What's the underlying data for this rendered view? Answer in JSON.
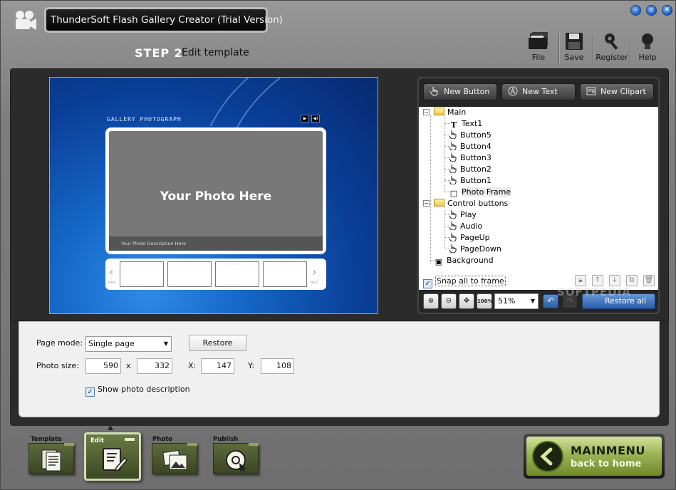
{
  "titlebar": {
    "title": "ThunderSoft Flash Gallery Creator (Trial Version)",
    "window_buttons": [
      "minimize-icon",
      "maximize-icon",
      "close-icon"
    ]
  },
  "header": {
    "step_label": "STEP 2",
    "step_title": "Edit template"
  },
  "toolbar": {
    "items": [
      {
        "label": "File",
        "icon": "folder-icon"
      },
      {
        "label": "Save",
        "icon": "floppy-disk-icon"
      },
      {
        "label": "Register",
        "icon": "key-icon"
      },
      {
        "label": "Help",
        "icon": "lightbulb-icon"
      }
    ]
  },
  "preview": {
    "gallery_title": "GALLERY PHOTOGRAPH",
    "photo_placeholder": "Your Photo Here",
    "photo_description": "Your Photo Description Here",
    "prev_label": "PREV",
    "next_label": "NEXT"
  },
  "editor_panel": {
    "buttons": {
      "new_button": "New Button",
      "new_text": "New Text",
      "new_clipart": "New Clipart"
    },
    "tree": {
      "main": "Main",
      "main_children": [
        "Text1",
        "Button5",
        "Button4",
        "Button3",
        "Button2",
        "Button1",
        "Photo Frame"
      ],
      "control_buttons": "Control buttons",
      "control_children": [
        "Play",
        "Audio",
        "PageUp",
        "PageDown"
      ],
      "background": "Background",
      "selected": "Photo Frame"
    },
    "snap_label": "Snap all to frame",
    "snap_checked": true,
    "zoom_value": "51%",
    "zoom_100_label": "100%",
    "restore_all_label": "Restore all"
  },
  "settings": {
    "page_mode_label": "Page mode:",
    "page_mode_value": "Single page",
    "restore_label": "Restore",
    "photo_size_label": "Photo size:",
    "width": "590",
    "times": "x",
    "height": "332",
    "x_label": "X:",
    "x_value": "147",
    "y_label": "Y:",
    "y_value": "108",
    "show_desc_label": "Show photo description",
    "show_desc_checked": true
  },
  "nav": {
    "tabs": [
      {
        "label": "Template",
        "icon": "template-pages-icon"
      },
      {
        "label": "Edit",
        "icon": "edit-notebook-icon"
      },
      {
        "label": "Photo",
        "icon": "photo-pictures-icon"
      },
      {
        "label": "Publish",
        "icon": "publish-disc-icon"
      }
    ],
    "active": "Edit"
  },
  "mainmenu": {
    "title": "MAINMENU",
    "subtitle": "back to home"
  },
  "watermark": "SOFTPEDIA",
  "colors": {
    "accent_blue": "#2b5eab",
    "nav_olive": "#5d6b3c",
    "mainmenu_green": "#9cb355"
  }
}
